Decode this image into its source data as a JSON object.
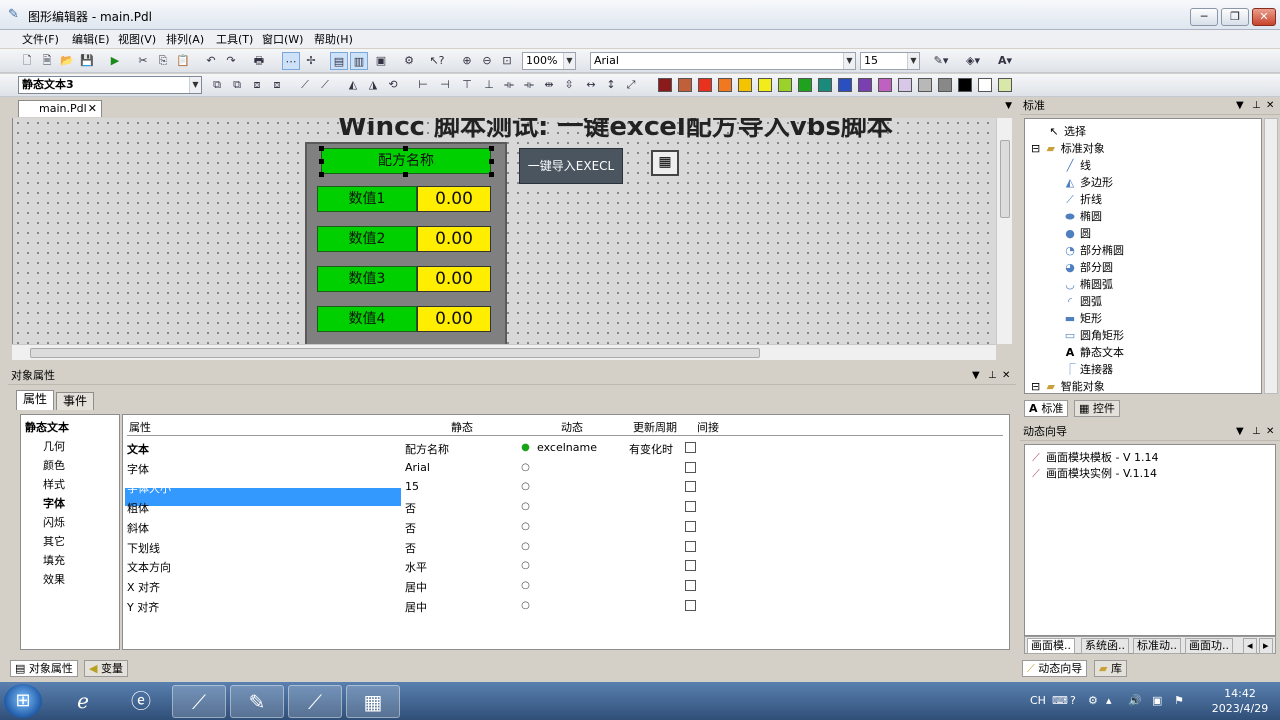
{
  "window": {
    "title": "图形编辑器 - main.Pdl"
  },
  "menu": [
    "文件(F)",
    "编辑(E)",
    "视图(V)",
    "排列(A)",
    "工具(T)",
    "窗口(W)",
    "帮助(H)"
  ],
  "toolbar": {
    "zoom": "100%",
    "font_name": "Arial",
    "font_size": "15",
    "object_selector": "静态文本3",
    "colors": [
      "#8b1a1a",
      "#c0603a",
      "#e8321e",
      "#f07820",
      "#f5c400",
      "#f2ec1a",
      "#9ad22a",
      "#1fa31f",
      "#1a8a7a",
      "#2a4fc0",
      "#7a3fb0",
      "#c060c0",
      "#d8c8e8",
      "#b8b8b8",
      "#888888",
      "#000000",
      "#ffffff",
      "#d8e8a8"
    ]
  },
  "document_tab": {
    "label": "main.Pdl"
  },
  "canvas": {
    "title": "Wincc 脚本测试: 一键excel配方导入vbs脚本",
    "recipe_name_label": "配方名称",
    "rows": [
      {
        "label": "数值1",
        "value": "0.00"
      },
      {
        "label": "数值2",
        "value": "0.00"
      },
      {
        "label": "数值3",
        "value": "0.00"
      },
      {
        "label": "数值4",
        "value": "0.00"
      }
    ],
    "import_button": "一键导入EXECL"
  },
  "properties_panel": {
    "title": "对象属性",
    "tabs": [
      "属性",
      "事件"
    ],
    "tree_root": "静态文本",
    "tree_items": [
      "几何",
      "颜色",
      "样式",
      "字体",
      "闪烁",
      "其它",
      "填充",
      "效果"
    ],
    "columns": [
      "属性",
      "静态",
      "动态",
      "更新周期",
      "间接"
    ],
    "rows": [
      {
        "name": "文本",
        "static": "配方名称",
        "dynamic": "excelname",
        "cycle": "有变化时",
        "bold": true,
        "bulb_on": true,
        "selected": false
      },
      {
        "name": "字体",
        "static": "Arial",
        "dynamic": "",
        "cycle": "",
        "bold": false,
        "bulb_on": false,
        "selected": false
      },
      {
        "name": "字体大小",
        "static": "15",
        "dynamic": "",
        "cycle": "",
        "bold": false,
        "bulb_on": false,
        "selected": true
      },
      {
        "name": "粗体",
        "static": "否",
        "dynamic": "",
        "cycle": "",
        "bold": false,
        "bulb_on": false,
        "selected": false
      },
      {
        "name": "斜体",
        "static": "否",
        "dynamic": "",
        "cycle": "",
        "bold": false,
        "bulb_on": false,
        "selected": false
      },
      {
        "name": "下划线",
        "static": "否",
        "dynamic": "",
        "cycle": "",
        "bold": false,
        "bulb_on": false,
        "selected": false
      },
      {
        "name": "文本方向",
        "static": "水平",
        "dynamic": "",
        "cycle": "",
        "bold": false,
        "bulb_on": false,
        "selected": false
      },
      {
        "name": "X 对齐",
        "static": "居中",
        "dynamic": "",
        "cycle": "",
        "bold": false,
        "bulb_on": false,
        "selected": false
      },
      {
        "name": "Y 对齐",
        "static": "居中",
        "dynamic": "",
        "cycle": "",
        "bold": false,
        "bulb_on": false,
        "selected": false
      }
    ]
  },
  "bottom_tabs": [
    "对象属性",
    "变量"
  ],
  "standard_panel": {
    "title": "标准",
    "select": "选择",
    "group": "标准对象",
    "items": [
      "线",
      "多边形",
      "折线",
      "椭圆",
      "圆",
      "部分椭圆",
      "部分圆",
      "椭圆弧",
      "圆弧",
      "矩形",
      "圆角矩形",
      "静态文本",
      "连接器"
    ],
    "smart_group": "智能对象",
    "tabs": [
      "标准",
      "控件"
    ]
  },
  "wizard_panel": {
    "title": "动态向导",
    "items": [
      "画面模块模板 - V 1.14",
      "画面模块实例 - V.1.14"
    ],
    "tabs": [
      "画面模..",
      "系统函..",
      "标准动..",
      "画面功.."
    ],
    "bottom_tabs": [
      "动态向导",
      "库"
    ]
  },
  "taskbar": {
    "time": "14:42",
    "date": "2023/4/29",
    "lang": "CH"
  }
}
